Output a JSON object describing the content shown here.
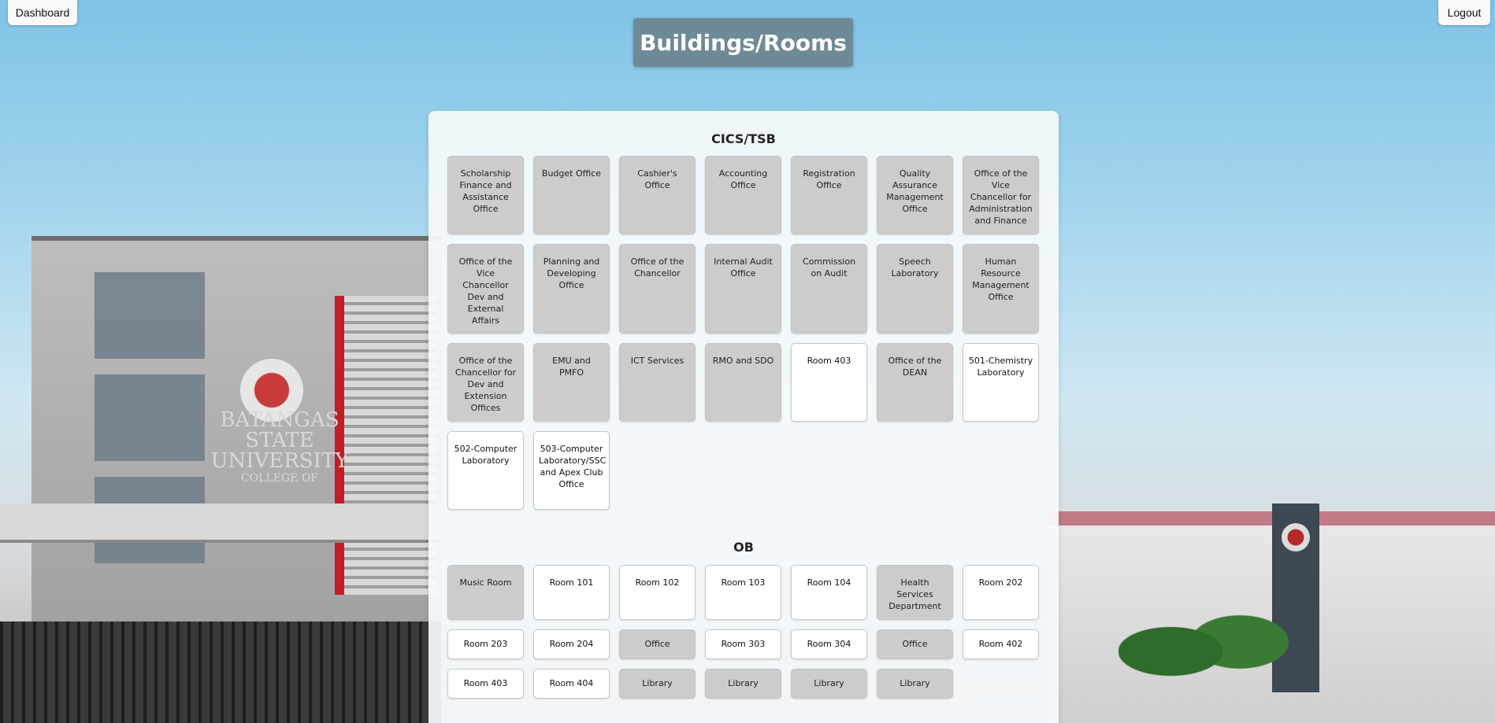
{
  "topbar": {
    "dashboard_label": "Dashboard",
    "logout_label": "Logout"
  },
  "page": {
    "title": "Buildings/Rooms"
  },
  "background": {
    "building_sign": "BATANGAS STATE UNIVERSITY",
    "building_sign_sub": "COLLEGE OF"
  },
  "colors": {
    "title_bg": "#6f8a97",
    "tile_unavailable": "#cccccc",
    "tile_available": "#ffffff"
  },
  "sections": [
    {
      "name": "CICS/TSB",
      "rooms": [
        {
          "label": "Scholarship Finance and Assistance Office",
          "state": "grey"
        },
        {
          "label": "Budget Office",
          "state": "grey"
        },
        {
          "label": "Cashier's Office",
          "state": "grey"
        },
        {
          "label": "Accounting Office",
          "state": "grey"
        },
        {
          "label": "Registration Office",
          "state": "grey"
        },
        {
          "label": "Quality Assurance Management Office",
          "state": "grey"
        },
        {
          "label": "Office of the Vice Chancellor for Administration and Finance",
          "state": "grey"
        },
        {
          "label": "Office of the Vice Chancellor Dev and External Affairs",
          "state": "grey"
        },
        {
          "label": "Planning and Developing Office",
          "state": "grey"
        },
        {
          "label": "Office of the Chancellor",
          "state": "grey"
        },
        {
          "label": "Internal Audit Office",
          "state": "grey"
        },
        {
          "label": "Commission on Audit",
          "state": "grey"
        },
        {
          "label": "Speech Laboratory",
          "state": "grey"
        },
        {
          "label": "Human Resource Management Office",
          "state": "grey"
        },
        {
          "label": "Office of the Chancellor for Dev and Extension Offices",
          "state": "grey"
        },
        {
          "label": "EMU and PMFO",
          "state": "grey"
        },
        {
          "label": "ICT Services",
          "state": "grey"
        },
        {
          "label": "RMO and SDO",
          "state": "grey"
        },
        {
          "label": "Room 403",
          "state": "white"
        },
        {
          "label": "Office of the DEAN",
          "state": "grey"
        },
        {
          "label": "501-Chemistry Laboratory",
          "state": "white"
        },
        {
          "label": "502-Computer Laboratory",
          "state": "white"
        },
        {
          "label": "503-Computer Laboratory/SSC and Apex Club Office",
          "state": "white"
        }
      ]
    },
    {
      "name": "OB",
      "rooms": [
        {
          "label": "Music Room",
          "state": "grey"
        },
        {
          "label": "Room 101",
          "state": "white"
        },
        {
          "label": "Room 102",
          "state": "white"
        },
        {
          "label": "Room 103",
          "state": "white"
        },
        {
          "label": "Room 104",
          "state": "white"
        },
        {
          "label": "Health Services Department",
          "state": "grey"
        },
        {
          "label": "Room 202",
          "state": "white"
        },
        {
          "label": "Room 203",
          "state": "white"
        },
        {
          "label": "Room 204",
          "state": "white"
        },
        {
          "label": "Office",
          "state": "grey"
        },
        {
          "label": "Room 303",
          "state": "white"
        },
        {
          "label": "Room 304",
          "state": "white"
        },
        {
          "label": "Office",
          "state": "grey"
        },
        {
          "label": "Room 402",
          "state": "white"
        },
        {
          "label": "Room 403",
          "state": "white"
        },
        {
          "label": "Room 404",
          "state": "white"
        },
        {
          "label": "Library",
          "state": "grey"
        },
        {
          "label": "Library",
          "state": "grey"
        },
        {
          "label": "Library",
          "state": "grey"
        },
        {
          "label": "Library",
          "state": "grey"
        }
      ]
    }
  ]
}
